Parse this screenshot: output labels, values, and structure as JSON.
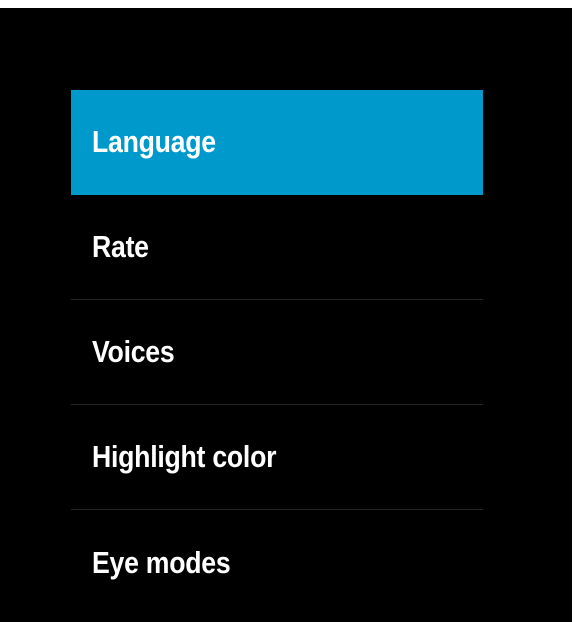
{
  "settings_menu": {
    "selected_index": 0,
    "colors": {
      "background": "#000000",
      "selected_background": "#0099cc",
      "text": "#ffffff",
      "divider": "#262626"
    },
    "items": [
      {
        "label": "Language"
      },
      {
        "label": "Rate"
      },
      {
        "label": "Voices"
      },
      {
        "label": "Highlight color"
      },
      {
        "label": "Eye modes"
      }
    ]
  }
}
